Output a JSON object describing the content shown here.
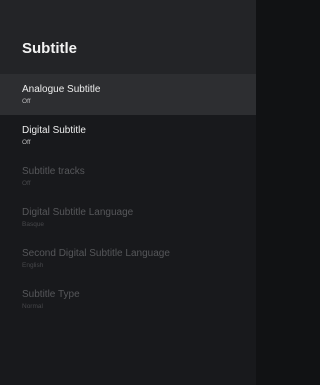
{
  "header": {
    "title": "Subtitle"
  },
  "items": [
    {
      "label": "Analogue Subtitle",
      "value": "Off"
    },
    {
      "label": "Digital Subtitle",
      "value": "Off"
    },
    {
      "label": "Subtitle tracks",
      "value": "Off"
    },
    {
      "label": "Digital Subtitle Language",
      "value": "Basque"
    },
    {
      "label": "Second Digital Subtitle Language",
      "value": "English"
    },
    {
      "label": "Subtitle Type",
      "value": "Normal"
    }
  ],
  "colors": {
    "background": "#18191c",
    "header_background": "#232427",
    "focused_row": "#2d2e31",
    "text_primary": "#ededed",
    "text_disabled": "#56575a"
  }
}
